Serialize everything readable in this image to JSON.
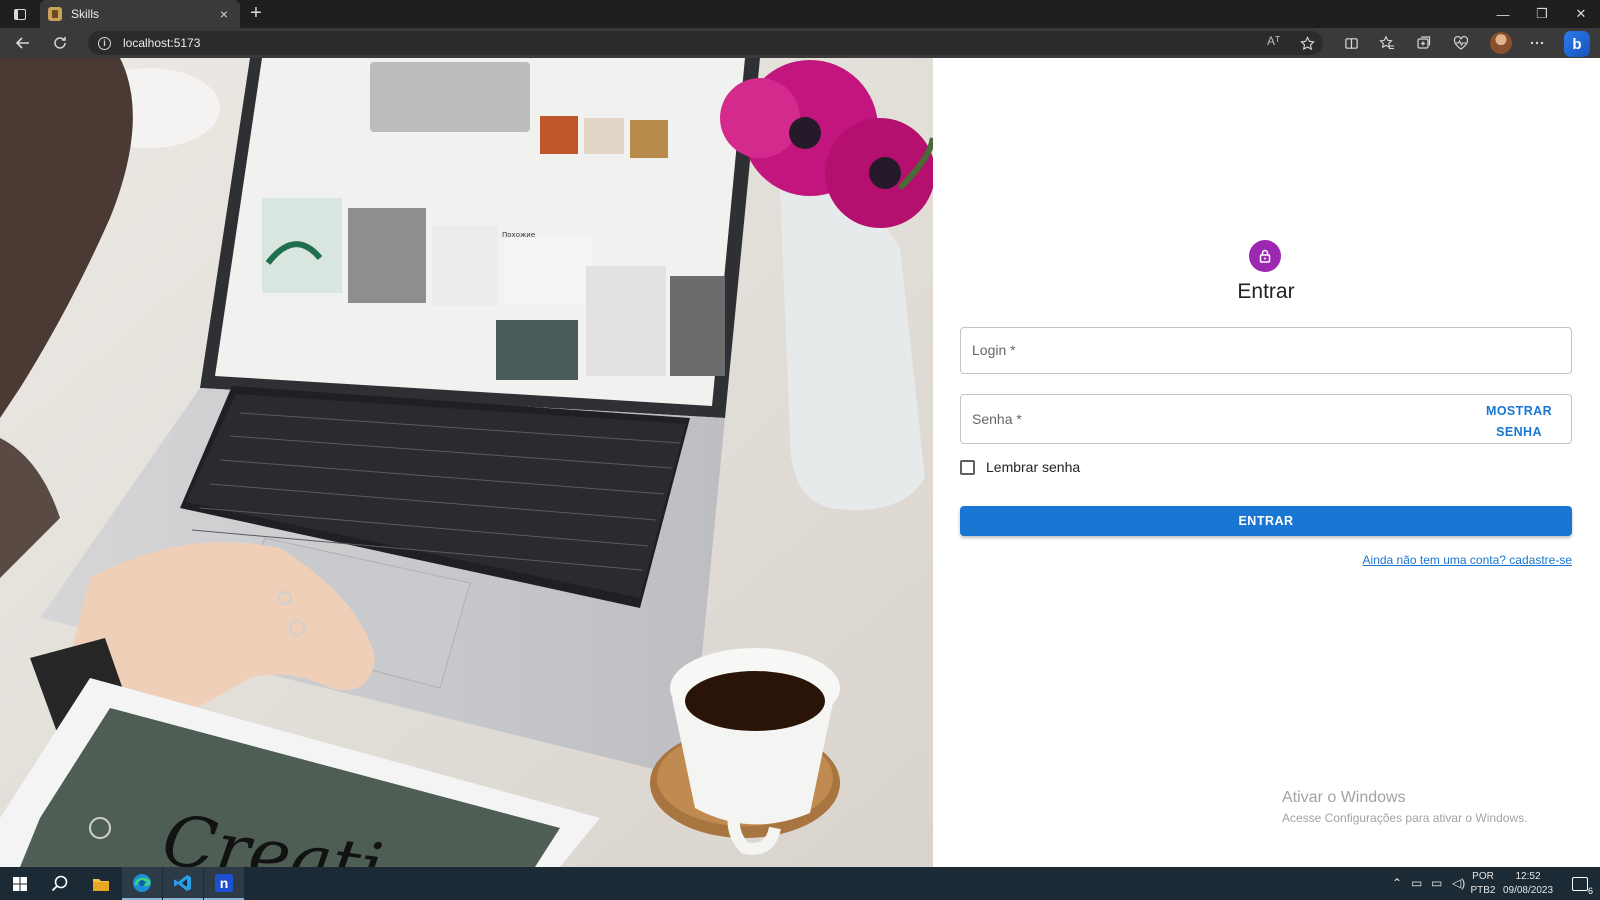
{
  "browser": {
    "tab_title": "Skills",
    "tab_close": "×",
    "new_tab": "+",
    "url": "localhost:5173",
    "read_aloud_label": "Aᵀ",
    "window_controls": {
      "minimize": "—",
      "restore": "❐",
      "close": "✕"
    }
  },
  "icons": {
    "tab_actions": "tab-actions-icon",
    "back": "back-arrow-icon",
    "refresh": "refresh-icon",
    "info": "info-icon",
    "favorite": "star-icon",
    "split_screen": "split-screen-icon",
    "favorites": "favorites-icon",
    "collections": "collections-icon",
    "browser_essentials": "heart-pulse-icon",
    "profile": "profile-avatar-icon",
    "more": "more-icon",
    "copilot": "copilot-icon",
    "lock": "lock-icon"
  },
  "hero": {
    "screen_caption": "Похожие",
    "tablet_lettering": "Creati"
  },
  "signin": {
    "title": "Entrar",
    "login_label": "Login *",
    "password_label": "Senha *",
    "show_password_line1": "MOSTRAR",
    "show_password_line2": "SENHA",
    "remember_label": "Lembrar senha",
    "submit_label": "ENTRAR",
    "signup_link": "Ainda não tem uma conta? cadastre-se"
  },
  "watermark": {
    "title": "Ativar o Windows",
    "subtitle": "Acesse Configurações para ativar o Windows."
  },
  "taskbar": {
    "apps": [
      "start",
      "search",
      "file-explorer",
      "edge",
      "vscode",
      "n-app"
    ],
    "lang_line1": "POR",
    "lang_line2": "PTB2",
    "time": "12:52",
    "date": "09/08/2023",
    "notification_count": "6"
  },
  "colors": {
    "accent": "#1976d2",
    "avatar": "#9c27b0",
    "titlebar": "#1f1f1f",
    "toolbar": "#3a3a3a",
    "taskbar": "#1b2a35"
  }
}
